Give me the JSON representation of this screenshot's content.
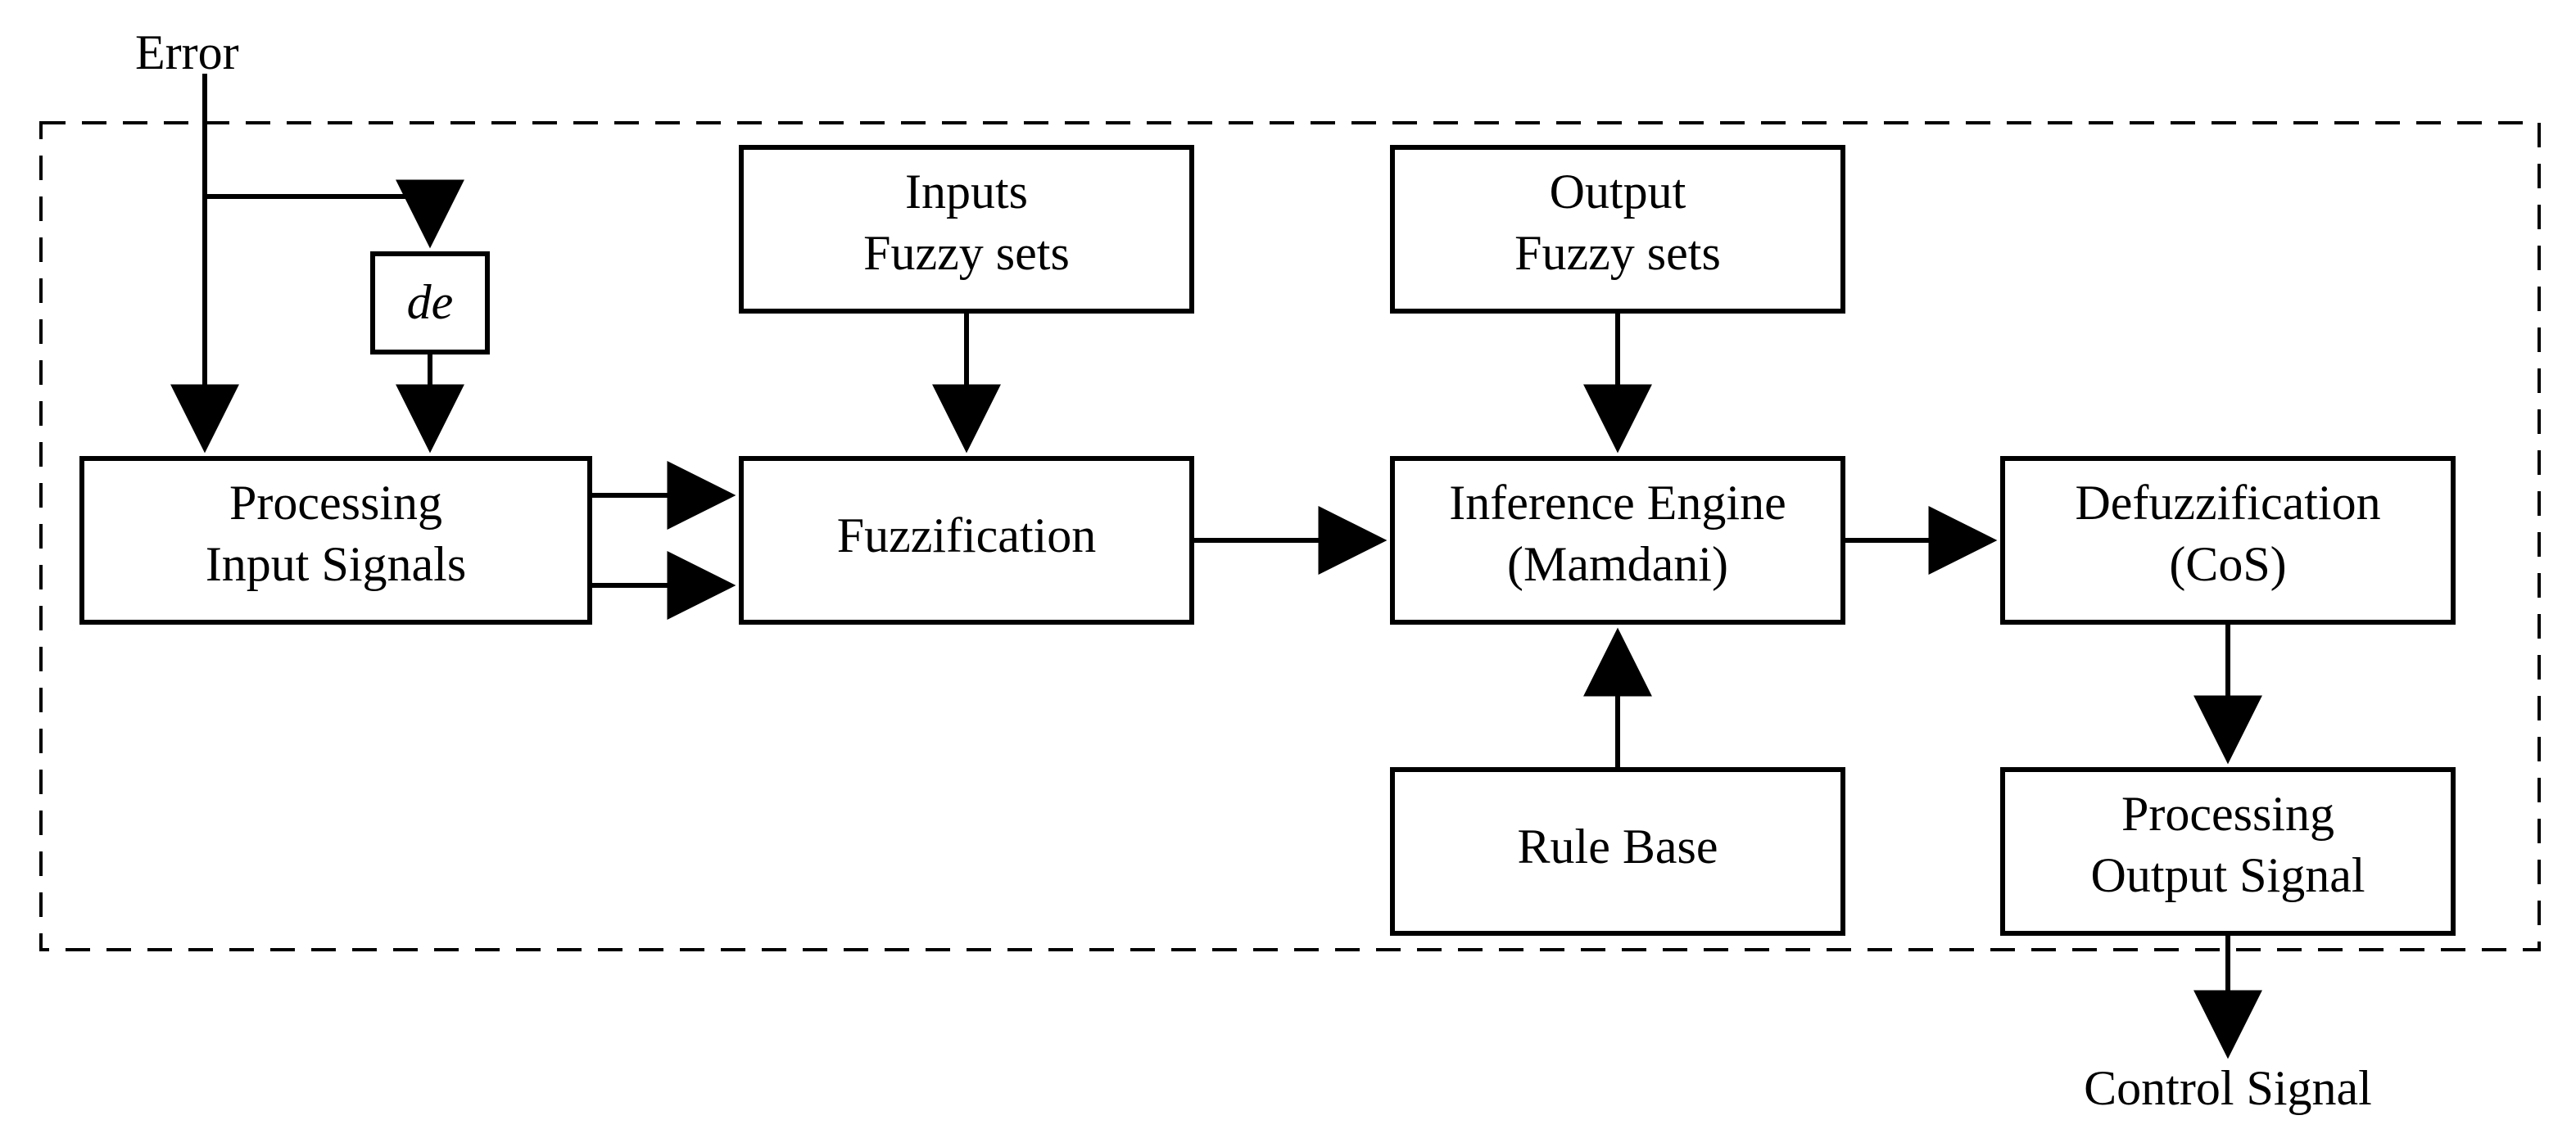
{
  "labels": {
    "error": "Error",
    "de": "de",
    "processing_input_1": "Processing",
    "processing_input_2": "Input Signals",
    "fuzzification": "Fuzzification",
    "inputs_fuzzy_1": "Inputs",
    "inputs_fuzzy_2": "Fuzzy sets",
    "output_fuzzy_1": "Output",
    "output_fuzzy_2": "Fuzzy sets",
    "inference_1": "Inference Engine",
    "inference_2": "(Mamdani)",
    "rule_base": "Rule Base",
    "defuzz_1": "Defuzzification",
    "defuzz_2": "(CoS)",
    "proc_out_1": "Processing",
    "proc_out_2": "Output Signal",
    "control_signal": "Control Signal"
  }
}
